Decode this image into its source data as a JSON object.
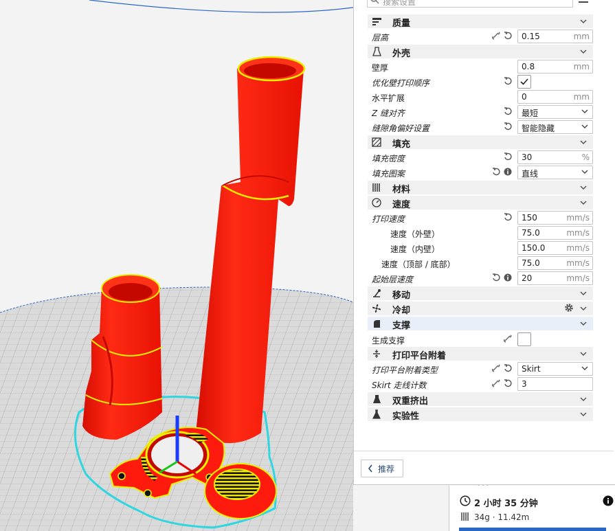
{
  "search": {
    "placeholder": "搜索设置"
  },
  "categories": {
    "quality": "质量",
    "shell": "外壳",
    "infill": "填充",
    "material": "材料",
    "speed": "速度",
    "travel": "移动",
    "cooling": "冷却",
    "support": "支撑",
    "adhesion": "打印平台附着",
    "dual": "双重挤出",
    "experimental": "实验性"
  },
  "settings": {
    "layer_height": {
      "label": "层高",
      "value": "0.15",
      "unit": "mm"
    },
    "wall_thickness": {
      "label": "壁厚",
      "value": "0.8",
      "unit": "mm"
    },
    "optimize_wall_order": {
      "label": "优化壁打印顺序",
      "checked": true
    },
    "horizontal_expansion": {
      "label": "水平扩展",
      "value": "0",
      "unit": "mm"
    },
    "z_seam": {
      "label": "Z 缝对齐",
      "value": "最短"
    },
    "seam_corner": {
      "label": "缝隙角偏好设置",
      "value": "智能隐藏"
    },
    "infill_density": {
      "label": "填充密度",
      "value": "30",
      "unit": "%"
    },
    "infill_pattern": {
      "label": "填充图案",
      "value": "直线"
    },
    "print_speed": {
      "label": "打印速度",
      "value": "150",
      "unit": "mm/s"
    },
    "speed_outer_wall": {
      "label": "速度（外壁）",
      "value": "75.0",
      "unit": "mm/s"
    },
    "speed_inner_wall": {
      "label": "速度（内壁）",
      "value": "150.0",
      "unit": "mm/s"
    },
    "speed_top_bottom": {
      "label": "速度（顶部 / 底部）",
      "value": "75.0",
      "unit": "mm/s"
    },
    "initial_layer_speed": {
      "label": "起始层速度",
      "value": "20",
      "unit": "mm/s"
    },
    "generate_support": {
      "label": "生成支撑",
      "checked": false
    },
    "adhesion_type": {
      "label": "打印平台附着类型",
      "value": "Skirt"
    },
    "skirt_line_count": {
      "label": "Skirt 走线计数",
      "value": "3"
    }
  },
  "recommended_button": "推荐",
  "print_info": {
    "time": "2 小时 35 分钟",
    "material": "34g · 11.42m"
  },
  "colors": {
    "model": "#ff1a0e",
    "model_dark": "#c40800",
    "layer_edge": "#e8f000",
    "skirt": "#2fd6e0",
    "bed_line": "#a9a9a9",
    "accent": "#2a66c4"
  }
}
